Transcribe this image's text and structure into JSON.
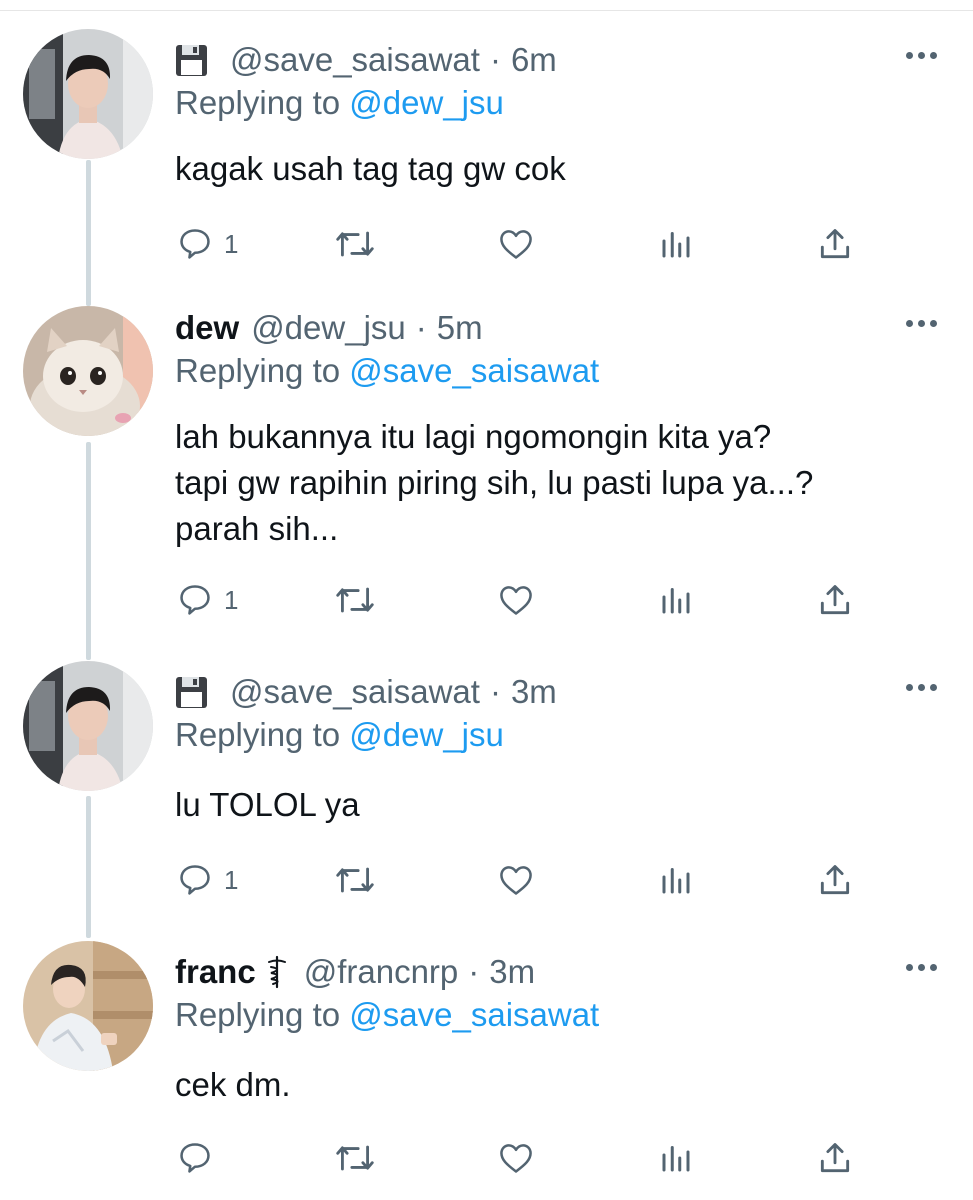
{
  "tweets": [
    {
      "name": "",
      "handle": "@save_saisawat",
      "time": "6m",
      "show_floppy": true,
      "replying_prefix": "Replying to",
      "replying_to": "@dew_jsu",
      "lines": [
        "kagak usah tag tag gw cok"
      ],
      "reply_count": "1",
      "avatar_icon": "person-avatar"
    },
    {
      "name": "dew",
      "handle": "@dew_jsu",
      "time": "5m",
      "show_floppy": false,
      "replying_prefix": "Replying to",
      "replying_to": "@save_saisawat",
      "lines": [
        "lah bukannya itu lagi ngomongin kita ya?",
        "tapi gw rapihin piring sih, lu pasti lupa ya...?",
        "parah sih..."
      ],
      "reply_count": "1",
      "avatar_icon": "cat-avatar"
    },
    {
      "name": "",
      "handle": "@save_saisawat",
      "time": "3m",
      "show_floppy": true,
      "replying_prefix": "Replying to",
      "replying_to": "@dew_jsu",
      "lines": [
        "lu TOLOL ya"
      ],
      "reply_count": "1",
      "avatar_icon": "person-avatar"
    },
    {
      "name": "franc",
      "handle": "@francnrp",
      "time": "3m",
      "show_floppy": false,
      "replying_prefix": "Replying to",
      "replying_to": "@save_saisawat",
      "lines": [
        "cek dm."
      ],
      "reply_count": "",
      "avatar_icon": "person-avatar"
    }
  ],
  "separator": "·",
  "colors": {
    "text": "#0f1419",
    "secondary": "#536471",
    "mention": "#1d9bf0",
    "thread_line": "#cfd9de"
  },
  "icons": [
    "floppy-disk-icon",
    "caduceus-icon",
    "more-icon",
    "reply-icon",
    "retweet-icon",
    "like-icon",
    "analytics-icon",
    "share-icon"
  ]
}
